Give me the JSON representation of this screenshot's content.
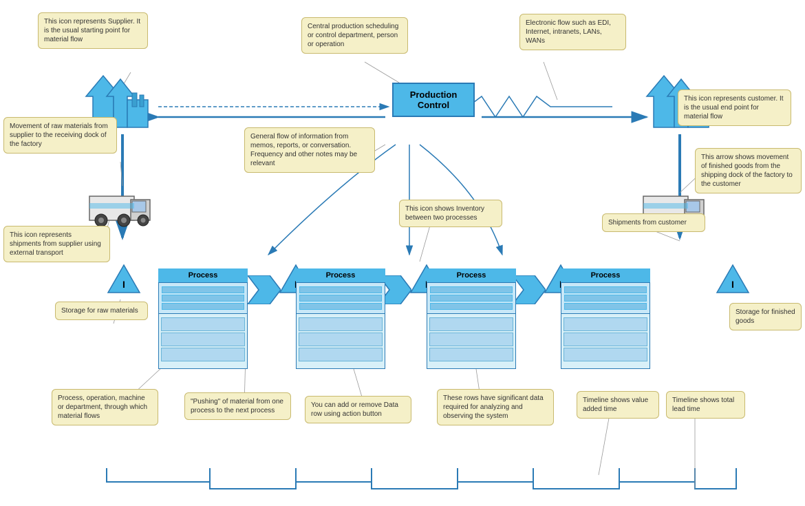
{
  "callouts": {
    "supplier_label": "This icon represents Supplier. It is the usual starting point for material flow",
    "prod_control_label": "Central production scheduling or control department, person or operation",
    "electronic_flow_label": "Electronic flow such as EDI, Internet, intranets, LANs, WANs",
    "customer_label": "This icon represents customer. It is the usual end point for material flow",
    "raw_material_movement": "Movement of raw materials from supplier to the receiving dock of the factory",
    "supplier_transport": "This icon represents shipments from supplier using external transport",
    "raw_storage": "Storage for raw materials",
    "process_label": "Process, operation, machine or department, through which material flows",
    "push_label": "\"Pushing\" of material from one process to the next process",
    "data_row_label": "You can add or remove Data row using action button",
    "inventory_label": "This icon shows Inventory between two processes",
    "info_flow_label": "General flow of information from memos, reports, or conversation. Frequency and other notes may be relevant",
    "data_significance": "These rows have significant data required for analyzing and observing the system",
    "finished_goods_arrow": "This arrow shows movement of finished goods from the shipping dock of the factory to the customer",
    "shipments_customer": "Shipments from customer",
    "finished_storage": "Storage for finished goods",
    "timeline_value": "Timeline shows value added time",
    "timeline_lead": "Timeline shows total lead time"
  },
  "process_labels": [
    "Process",
    "Process",
    "Process",
    "Process"
  ],
  "prod_control_title": "Production Control",
  "colors": {
    "blue_dark": "#2a7ab5",
    "blue_mid": "#4db8e8",
    "blue_light": "#a8d8f0",
    "callout_bg": "#f5f0c8",
    "callout_border": "#c8b96e"
  }
}
